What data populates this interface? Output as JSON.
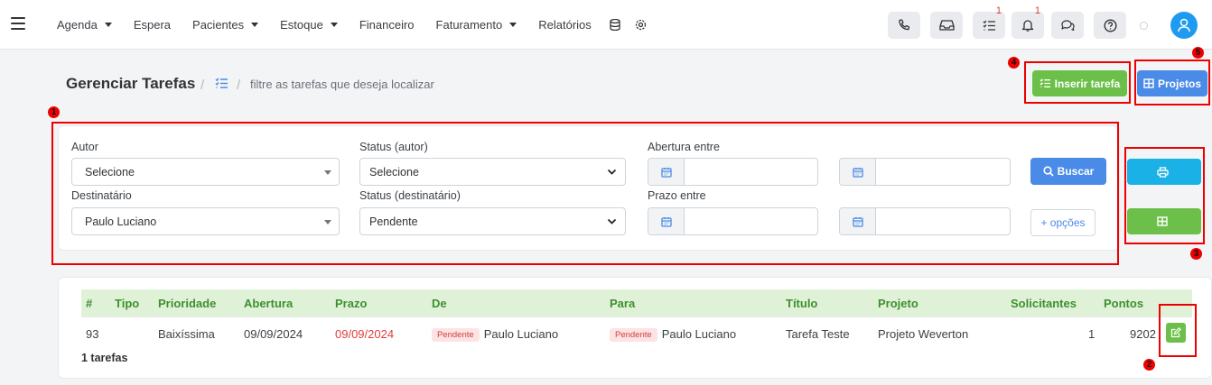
{
  "nav": {
    "items": [
      {
        "label": "Agenda",
        "dropdown": true
      },
      {
        "label": "Espera",
        "dropdown": false
      },
      {
        "label": "Pacientes",
        "dropdown": true
      },
      {
        "label": "Estoque",
        "dropdown": true
      },
      {
        "label": "Financeiro",
        "dropdown": false
      },
      {
        "label": "Faturamento",
        "dropdown": true
      },
      {
        "label": "Relatórios",
        "dropdown": false
      }
    ],
    "tasks_badge": "1",
    "notifications_badge": "1"
  },
  "header": {
    "title": "Gerenciar Tarefas",
    "separator": "/",
    "subtitle": "filtre as tarefas que deseja localizar",
    "insert_label": "Inserir tarefa",
    "projects_label": "Projetos"
  },
  "filters": {
    "autor_label": "Autor",
    "autor_value": "Selecione",
    "status_autor_label": "Status (autor)",
    "status_autor_value": "Selecione",
    "abertura_label": "Abertura entre",
    "destinatario_label": "Destinatário",
    "destinatario_value": "Paulo Luciano",
    "status_dest_label": "Status (destinatário)",
    "status_dest_value": "Pendente",
    "prazo_label": "Prazo entre",
    "search_label": "Buscar",
    "more_label": "+ opções"
  },
  "table": {
    "columns": [
      "#",
      "Tipo",
      "Prioridade",
      "Abertura",
      "Prazo",
      "De",
      "Para",
      "Título",
      "Projeto",
      "Solicitantes",
      "Pontos"
    ],
    "rows": [
      {
        "id": "93",
        "tipo": "",
        "prioridade": "Baixíssima",
        "abertura": "09/09/2024",
        "prazo": "09/09/2024",
        "de_status": "Pendente",
        "de_nome": "Paulo Luciano",
        "para_status": "Pendente",
        "para_nome": "Paulo Luciano",
        "titulo": "Tarefa Teste",
        "projeto": "Projeto Weverton",
        "solicitantes": "1",
        "pontos": "9202"
      }
    ],
    "count_label": "1 tarefas"
  },
  "annotations": [
    "1",
    "2",
    "3",
    "4",
    "5"
  ],
  "colors": {
    "accent_green": "#6cc04a",
    "accent_blue": "#4a8be8",
    "accent_cyan": "#1ab1e6",
    "danger": "#e03d3d"
  }
}
